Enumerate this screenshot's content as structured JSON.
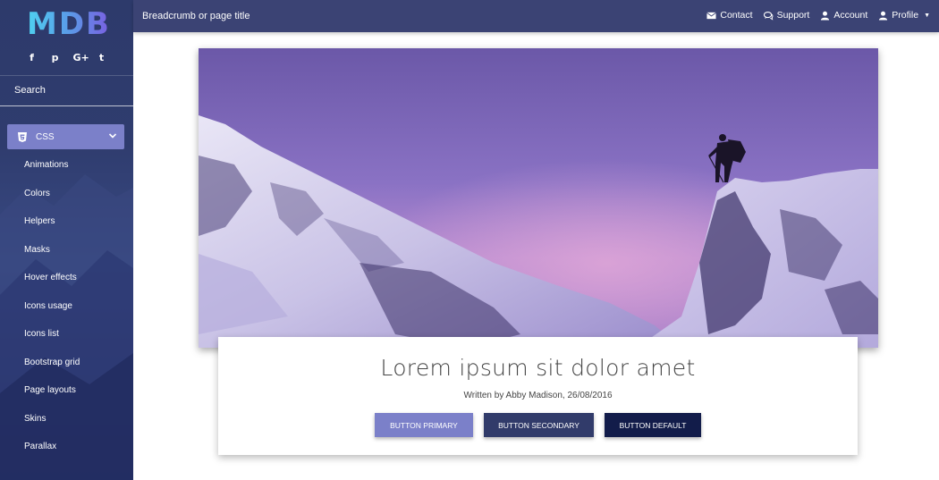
{
  "brand": {
    "logo_text": "MDB"
  },
  "sidebar": {
    "social_icons": [
      "facebook-icon",
      "pinterest-icon",
      "google-plus-icon",
      "twitter-icon"
    ],
    "social_glyphs": [
      "f",
      "p",
      "G+",
      "t"
    ],
    "search_label": "Search",
    "active_section": {
      "label": "CSS",
      "icon": "css3-icon"
    },
    "items": [
      {
        "label": "Animations"
      },
      {
        "label": "Colors"
      },
      {
        "label": "Helpers"
      },
      {
        "label": "Masks"
      },
      {
        "label": "Hover effects"
      },
      {
        "label": "Icons usage"
      },
      {
        "label": "Icons list"
      },
      {
        "label": "Bootstrap grid"
      },
      {
        "label": "Page layouts"
      },
      {
        "label": "Skins"
      },
      {
        "label": "Parallax"
      }
    ]
  },
  "topbar": {
    "breadcrumb": "Breadcrumb or page title",
    "links": [
      {
        "label": "Contact",
        "icon": "envelope-icon"
      },
      {
        "label": "Support",
        "icon": "comments-icon"
      },
      {
        "label": "Account",
        "icon": "user-icon"
      },
      {
        "label": "Profile",
        "icon": "user-icon"
      }
    ]
  },
  "card": {
    "title": "Lorem ipsum sit dolor amet",
    "byline": "Written by Abby Madison, 26/08/2016",
    "buttons": {
      "primary": "BUTTON PRIMARY",
      "secondary": "BUTTON SECONDARY",
      "default": "BUTTON DEFAULT"
    }
  },
  "colors": {
    "accent": "#7b80c9",
    "navbar": "#3b4374",
    "secondary": "#313b6a",
    "default": "#121c4a"
  }
}
